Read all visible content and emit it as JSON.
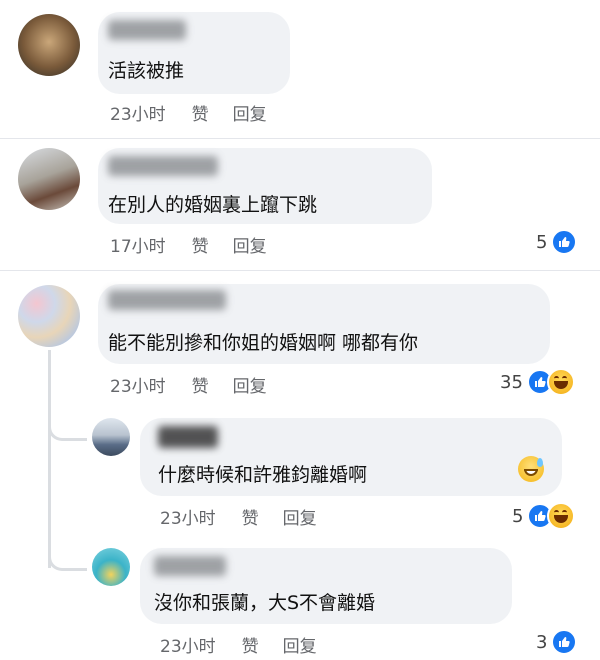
{
  "comments": [
    {
      "text": "活該被推",
      "time": "23小时",
      "like": "赞",
      "reply": "回复",
      "count": ""
    },
    {
      "text": "在別人的婚姻裏上躥下跳",
      "time": "17小时",
      "like": "赞",
      "reply": "回复",
      "count": "5"
    },
    {
      "text": "能不能別摻和你姐的婚姻啊 哪都有你",
      "time": "23小时",
      "like": "赞",
      "reply": "回复",
      "count": "35"
    },
    {
      "text": "什麼時候和許雅鈞離婚啊",
      "time": "23小时",
      "like": "赞",
      "reply": "回复",
      "count": "5"
    },
    {
      "text": "沒你和張蘭，大S不會離婚",
      "time": "23小时",
      "like": "赞",
      "reply": "回复",
      "count": "3"
    }
  ],
  "icons": {
    "like": "like-icon",
    "haha": "haha-icon",
    "emoji": "sweat-smile-emoji"
  },
  "colors": {
    "bubble": "#f0f2f5",
    "like_blue": "#1877f2",
    "meta_gray": "#65676b"
  }
}
